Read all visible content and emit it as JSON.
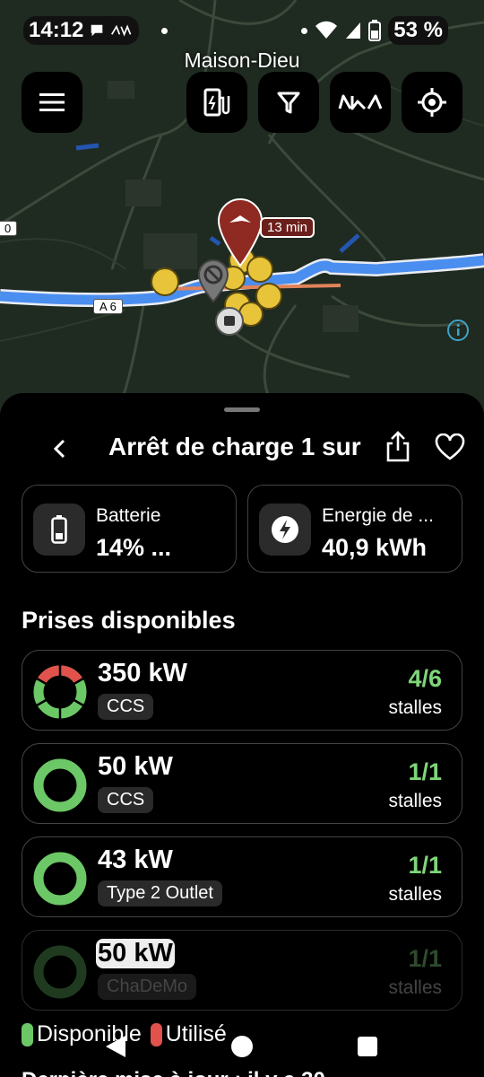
{
  "status": {
    "time": "14:12",
    "battery_pct": "53 %"
  },
  "map": {
    "place_name": "Maison-Dieu",
    "road_label": "A 6",
    "road_label_left": "0",
    "eta_badge": "13 min",
    "buttons": [
      "menu",
      "charger-filter",
      "filter",
      "kia",
      "locate"
    ]
  },
  "sheet": {
    "title": "Arrêt de charge 1 sur",
    "battery_card": {
      "label": "Batterie",
      "value": "14% ..."
    },
    "energy_card": {
      "label": "Energie de ...",
      "value": "40,9 kWh"
    },
    "section_title": "Prises disponibles",
    "plugs": [
      {
        "power": "350 kW",
        "connector": "CCS",
        "available": "4/6",
        "stalls_label": "stalles",
        "used_fraction": 0.33,
        "dim": false
      },
      {
        "power": "50 kW",
        "connector": "CCS",
        "available": "1/1",
        "stalls_label": "stalles",
        "used_fraction": 0,
        "dim": false
      },
      {
        "power": "43 kW",
        "connector": "Type 2 Outlet",
        "available": "1/1",
        "stalls_label": "stalles",
        "used_fraction": 0,
        "dim": false
      },
      {
        "power": "50 kW",
        "connector": "ChaDeMo",
        "available": "1/1",
        "stalls_label": "stalles",
        "used_fraction": 0,
        "dim": true
      }
    ],
    "legend": {
      "available": "Disponible",
      "used": "Utilisé"
    },
    "footer_partial": "Dernière mise à jour : il y a 30"
  },
  "colors": {
    "available": "#6cc866",
    "used": "#e0524b",
    "route": "#4a8ef0",
    "marker_brand": "#8f2a22",
    "marker_yellow": "#e8c43a"
  }
}
